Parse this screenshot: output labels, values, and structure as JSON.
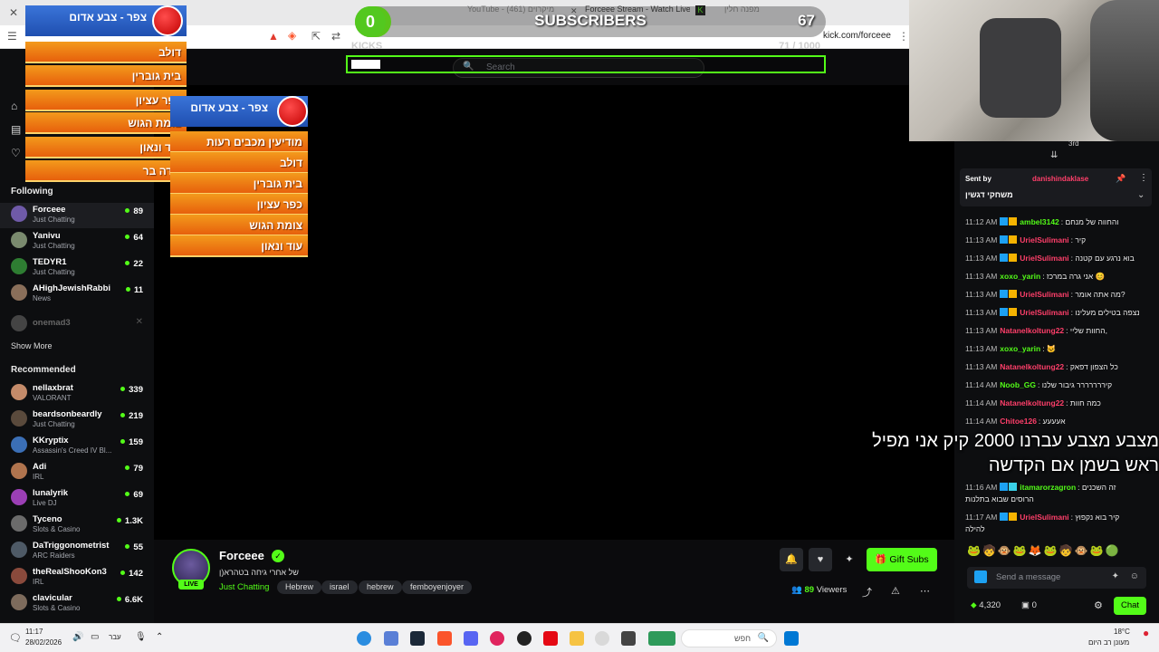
{
  "browser": {
    "tabs": [
      "YouTube - מיקרוים (461)",
      "Forceee Stream - Watch Live on",
      "מפנה חלין"
    ],
    "url": "kick.com/forceee"
  },
  "subs_overlay": {
    "count": "0",
    "title": "SUBSCRIBERS",
    "goal": "67"
  },
  "kicks_overlay": {
    "label": "KICKS",
    "progress_text": "71 / 1000"
  },
  "search": {
    "placeholder": "Search"
  },
  "sidebar": {
    "following_label": "Following",
    "following": [
      {
        "name": "Forceee",
        "category": "Just Chatting",
        "viewers": "89"
      },
      {
        "name": "Yanivu",
        "category": "Just Chatting",
        "viewers": "64"
      },
      {
        "name": "TEDYR1",
        "category": "Just Chatting",
        "viewers": "22"
      },
      {
        "name": "AHighJewishRabbi",
        "category": "News",
        "viewers": "11"
      },
      {
        "name": "onemad3",
        "category": "",
        "viewers": ""
      }
    ],
    "show_more": "Show More",
    "recommended_label": "Recommended",
    "recommended": [
      {
        "name": "nellaxbrat",
        "category": "VALORANT",
        "viewers": "339"
      },
      {
        "name": "beardsonbeardly",
        "category": "Just Chatting",
        "viewers": "219"
      },
      {
        "name": "KKryptix",
        "category": "Assassin's Creed IV Bl...",
        "viewers": "159"
      },
      {
        "name": "Adi",
        "category": "IRL",
        "viewers": "79"
      },
      {
        "name": "lunalyrik",
        "category": "Live DJ",
        "viewers": "69"
      },
      {
        "name": "Tyceno",
        "category": "Slots & Casino",
        "viewers": "1.3K"
      },
      {
        "name": "DaTriggonometrist",
        "category": "ARC Raiders",
        "viewers": "55"
      },
      {
        "name": "theRealShooKon3",
        "category": "IRL",
        "viewers": "142"
      },
      {
        "name": "clavicular",
        "category": "Slots & Casino",
        "viewers": "6.6K"
      }
    ]
  },
  "alert_overlay_top": {
    "header": "צפר - צבע אדום",
    "rows": [
      "דולב",
      "בית גוברין",
      "כפר עציון",
      "צומת הגוש",
      "עוד ונאון",
      "שדה בר"
    ]
  },
  "alert_overlay_mid": {
    "header": "צפר - צבע אדום",
    "rows": [
      "מודיעין מכבים רעות",
      "דולב",
      "בית גוברין",
      "כפר עציון",
      "צומת הגוש",
      "עוד ונאון"
    ]
  },
  "stream": {
    "name": "Forceee",
    "live": "LIVE",
    "title": "של אחרי גיחה בטהרא(ן",
    "category": "Just Chatting",
    "tags": [
      "Hebrew",
      "israel",
      "hebrew",
      "femboyenjoyer"
    ],
    "viewers": "89",
    "viewers_label": "Viewers",
    "gift_label": "Gift Subs"
  },
  "chat": {
    "rank": "3rd",
    "pinned": {
      "sent_by": "Sent by",
      "user": "danishindaklase",
      "text": "משחקי דגשין"
    },
    "messages": [
      {
        "time": "11:12 AM",
        "user": "ambel3142",
        "color": "#53fc18",
        "text": "והחווה של מנחם"
      },
      {
        "time": "11:13 AM",
        "user": "UrielSulimani",
        "color": "#ff3f6a",
        "text": "קיר"
      },
      {
        "time": "11:13 AM",
        "user": "UrielSulimani",
        "color": "#ff3f6a",
        "text": "בוא נרגע עם קטנה"
      },
      {
        "time": "11:13 AM",
        "user": "xoxo_yarin",
        "color": "#53fc18",
        "text": "אני גרה במרכז 😊"
      },
      {
        "time": "11:13 AM",
        "user": "UrielSulimani",
        "color": "#ff3f6a",
        "text": "מה אתה אומר?"
      },
      {
        "time": "11:13 AM",
        "user": "UrielSulimani",
        "color": "#ff3f6a",
        "text": "נצפה בטילים מעלינו"
      },
      {
        "time": "11:13 AM",
        "user": "Natanelkoltung22",
        "color": "#ff3f6a",
        "text": "החוות שליי,"
      },
      {
        "time": "11:13 AM",
        "user": "xoxo_yarin",
        "color": "#53fc18",
        "text": "🐱"
      },
      {
        "time": "11:13 AM",
        "user": "Natanelkoltung22",
        "color": "#ff3f6a",
        "text": "כל הצפון דפאק"
      },
      {
        "time": "11:14 AM",
        "user": "Noob_GG",
        "color": "#53fc18",
        "text": "קיררררררר גיבור שלנו"
      },
      {
        "time": "11:14 AM",
        "user": "Natanelkoltung22",
        "color": "#ff3f6a",
        "text": "כמה חוות"
      },
      {
        "time": "11:14 AM",
        "user": "Chitoe126",
        "color": "#ff3f6a",
        "text": "אעעעע"
      },
      {
        "time": "11:16 AM",
        "user": "itamarorzagron",
        "color": "#53fc18",
        "text": "זה השכנים"
      },
      {
        "time": "",
        "user": "",
        "color": "#ffffff",
        "text": "הרוסים שבוא בתלנות"
      },
      {
        "time": "11:17 AM",
        "user": "UrielSulimani",
        "color": "#ff3f6a",
        "text": "קיר בוא נקפוץ"
      },
      {
        "time": "",
        "user": "",
        "color": "#ffffff",
        "text": "להילה"
      }
    ],
    "big_overlay_text": "מצבע מצבע עברנו 2000 קיק אני מפיל ראש בשמן אם הקדשה",
    "input_placeholder": "Send a message",
    "points": "4,320",
    "items": "0",
    "chat_button": "Chat"
  },
  "taskbar": {
    "time": "11:17",
    "date": "28/02/2026",
    "lang": "עבר",
    "search_text": "חפש",
    "weather_temp": "18°C",
    "weather_text": "מעונן רב היום"
  },
  "colors": {
    "kick_green": "#53fc18",
    "overlay_orange": "#f39a1c",
    "overlay_blue": "#2a5fc4"
  }
}
